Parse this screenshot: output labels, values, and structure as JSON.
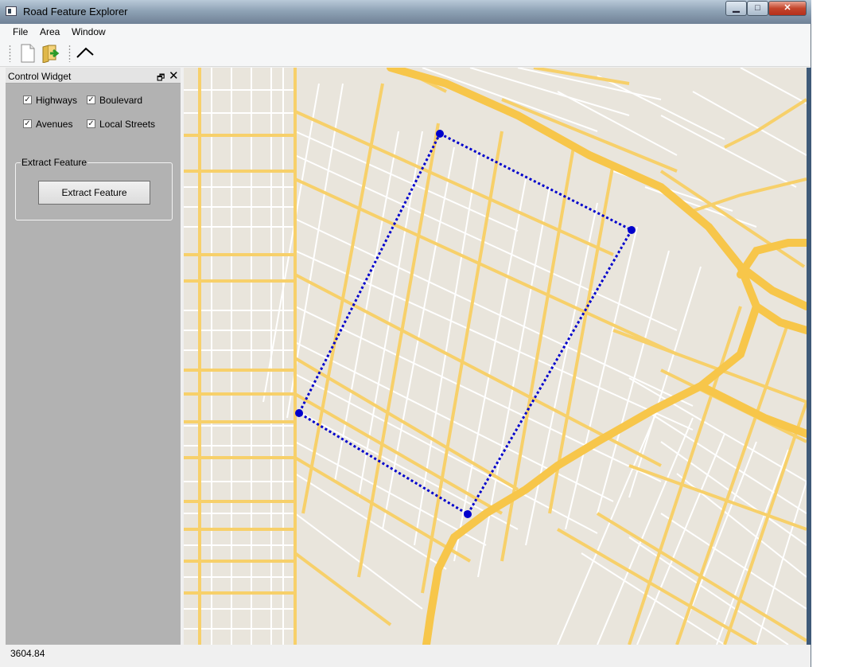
{
  "window": {
    "title": "Road Feature Explorer"
  },
  "window_controls": {
    "minimize": "▁",
    "maximize": "□",
    "close": "✕"
  },
  "menu": {
    "items": [
      "File",
      "Area",
      "Window"
    ]
  },
  "toolbar": {
    "buttons": [
      "new-file-icon",
      "open-folder-icon",
      "draw-polyline-icon"
    ]
  },
  "dock": {
    "title": "Control Widget",
    "float_glyph": "🗗",
    "close_glyph": "✕",
    "checkboxes": [
      {
        "label": "Highways",
        "checked": true
      },
      {
        "label": "Boulevard",
        "checked": true
      },
      {
        "label": "Avenues",
        "checked": true
      },
      {
        "label": "Local Streets",
        "checked": true
      }
    ],
    "group_title": "Extract Feature",
    "extract_button": "Extract Feature"
  },
  "map": {
    "background_color": "#e9e5dc",
    "major_road_color": "#f7d06a",
    "local_road_color": "#ffffff",
    "selection_color": "#0000cc"
  },
  "status": {
    "text": "3604.84"
  }
}
